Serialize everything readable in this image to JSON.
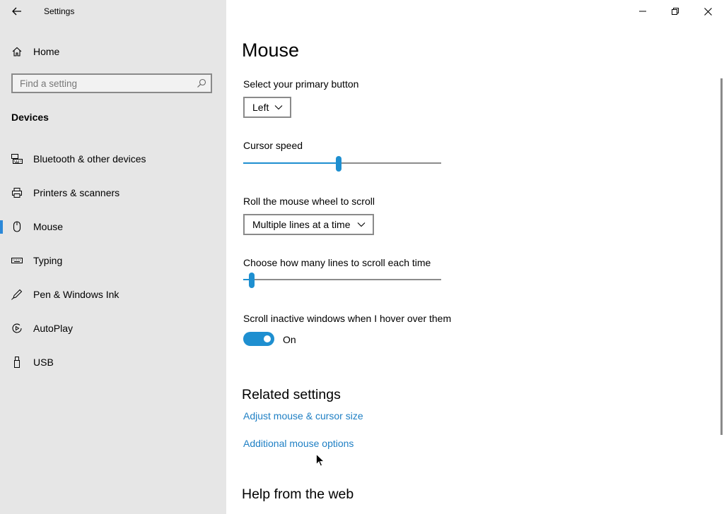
{
  "app": {
    "title": "Settings"
  },
  "sidebar": {
    "home_label": "Home",
    "search_placeholder": "Find a setting",
    "section": "Devices",
    "items": [
      {
        "label": "Bluetooth & other devices",
        "icon": "bluetooth-keyboard-icon"
      },
      {
        "label": "Printers & scanners",
        "icon": "printer-icon"
      },
      {
        "label": "Mouse",
        "icon": "mouse-icon",
        "selected": true
      },
      {
        "label": "Typing",
        "icon": "keyboard-icon"
      },
      {
        "label": "Pen & Windows Ink",
        "icon": "pen-icon"
      },
      {
        "label": "AutoPlay",
        "icon": "autoplay-icon"
      },
      {
        "label": "USB",
        "icon": "usb-icon"
      }
    ]
  },
  "main": {
    "title": "Mouse",
    "primary_button": {
      "label": "Select your primary button",
      "value": "Left"
    },
    "cursor_speed": {
      "label": "Cursor speed",
      "level": 0.48
    },
    "wheel_scroll": {
      "label": "Roll the mouse wheel to scroll",
      "value": "Multiple lines at a time"
    },
    "lines_to_scroll": {
      "label": "Choose how many lines to scroll each time",
      "level": 0.03
    },
    "scroll_inactive": {
      "label": "Scroll inactive windows when I hover over them",
      "state": "On",
      "on": true
    },
    "related": {
      "title": "Related settings",
      "links": [
        "Adjust mouse & cursor size",
        "Additional mouse options"
      ]
    },
    "help_title": "Help from the web"
  },
  "colors": {
    "accent": "#1e8fd0",
    "link": "#1e7fc4",
    "sidebar_bg": "#e6e6e6"
  }
}
